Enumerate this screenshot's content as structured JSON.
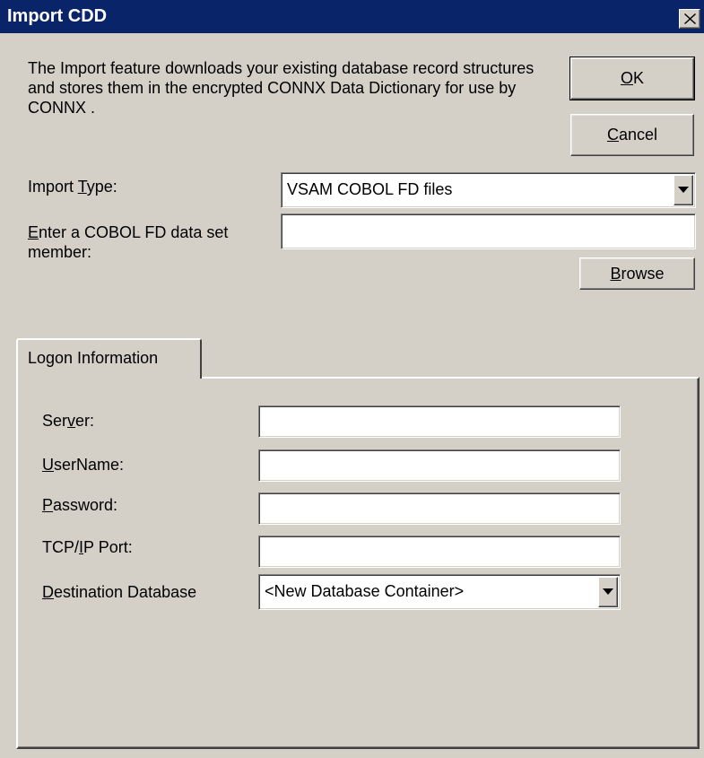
{
  "window": {
    "title": "Import CDD",
    "close_icon": "close-icon"
  },
  "description": "The Import feature downloads your existing database record structures and stores them in the encrypted CONNX Data Dictionary for use by CONNX .",
  "buttons": {
    "ok": {
      "accel": "O",
      "rest": "K"
    },
    "cancel": {
      "accel": "C",
      "rest": "ancel"
    },
    "browse": {
      "accel": "B",
      "rest": "rowse"
    }
  },
  "import_type": {
    "label_pre": "Import ",
    "label_accel": "T",
    "label_post": "ype:",
    "selected": "VSAM COBOL FD files",
    "arrow_icon": "chevron-down-icon"
  },
  "cobol_member": {
    "label_accel": "E",
    "label_line1_rest": "nter a COBOL FD data set",
    "label_line2": "member:",
    "value": ""
  },
  "tabs": [
    {
      "label": "Logon Information",
      "active": true
    }
  ],
  "logon": {
    "server": {
      "label_pre": "Ser",
      "label_accel": "v",
      "label_post": "er:",
      "value": ""
    },
    "username": {
      "label_accel": "U",
      "label_post": "serName:",
      "value": ""
    },
    "password": {
      "label_accel": "P",
      "label_post": "assword:",
      "value": ""
    },
    "tcpip_port": {
      "label_pre": "TCP/",
      "label_accel": "I",
      "label_post": "P Port:",
      "value": ""
    },
    "destination_db": {
      "label_accel": "D",
      "label_post": "estination Database",
      "selected": "<New Database Container>",
      "arrow_icon": "chevron-down-icon"
    }
  },
  "colors": {
    "titlebar": "#0a246a",
    "dialog_face": "#d4d0c8",
    "field_bg": "#ffffff"
  }
}
